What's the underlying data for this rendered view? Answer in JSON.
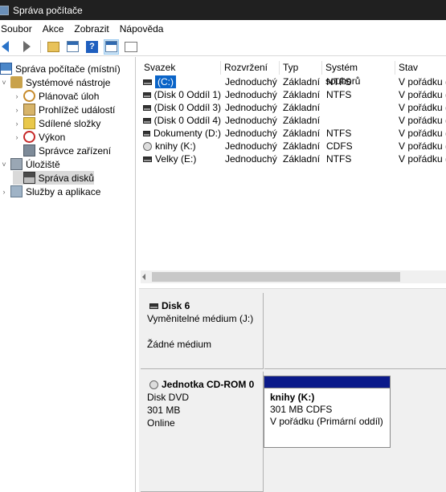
{
  "window": {
    "title": "Správa počítače"
  },
  "menu": [
    "Soubor",
    "Akce",
    "Zobrazit",
    "Nápověda"
  ],
  "tree": [
    {
      "label": "Správa počítače (místní)",
      "indent": 0,
      "exp": "",
      "icon": "computer"
    },
    {
      "label": "Systémové nástroje",
      "indent": 1,
      "exp": "˅",
      "icon": "tools"
    },
    {
      "label": "Plánovač úloh",
      "indent": 2,
      "exp": "›",
      "icon": "clock"
    },
    {
      "label": "Prohlížeč událostí",
      "indent": 2,
      "exp": "›",
      "icon": "events"
    },
    {
      "label": "Sdílené složky",
      "indent": 2,
      "exp": "›",
      "icon": "shared"
    },
    {
      "label": "Výkon",
      "indent": 2,
      "exp": "›",
      "icon": "perf"
    },
    {
      "label": "Správce zařízení",
      "indent": 2,
      "exp": "",
      "icon": "devmgr"
    },
    {
      "label": "Úložiště",
      "indent": 1,
      "exp": "˅",
      "icon": "storage"
    },
    {
      "label": "Správa disků",
      "indent": 2,
      "exp": "",
      "icon": "diskmgmt",
      "selected": true
    },
    {
      "label": "Služby a aplikace",
      "indent": 1,
      "exp": "›",
      "icon": "services"
    }
  ],
  "columns": [
    "Svazek",
    "Rozvržení",
    "Typ",
    "Systém souborů",
    "Stav"
  ],
  "volumes": [
    {
      "name": "(C:)",
      "layout": "Jednoduchý",
      "type": "Základní",
      "fs": "NTFS",
      "status": "V pořádku (",
      "icon": "disk",
      "selected": true
    },
    {
      "name": "(Disk 0 Oddíl 1)",
      "layout": "Jednoduchý",
      "type": "Základní",
      "fs": "NTFS",
      "status": "V pořádku (",
      "icon": "disk"
    },
    {
      "name": "(Disk 0 Oddíl 3)",
      "layout": "Jednoduchý",
      "type": "Základní",
      "fs": "",
      "status": "V pořádku (",
      "icon": "disk"
    },
    {
      "name": "(Disk 0 Oddíl 4)",
      "layout": "Jednoduchý",
      "type": "Základní",
      "fs": "",
      "status": "V pořádku (",
      "icon": "disk"
    },
    {
      "name": "Dokumenty (D:)",
      "layout": "Jednoduchý",
      "type": "Základní",
      "fs": "NTFS",
      "status": "V pořádku (",
      "icon": "disk"
    },
    {
      "name": "knihy (K:)",
      "layout": "Jednoduchý",
      "type": "Základní",
      "fs": "CDFS",
      "status": "V pořádku (",
      "icon": "cd"
    },
    {
      "name": "Velky (E:)",
      "layout": "Jednoduchý",
      "type": "Základní",
      "fs": "NTFS",
      "status": "V pořádku (",
      "icon": "disk"
    }
  ],
  "disks": {
    "disk6": {
      "title": "Disk 6",
      "line1": "Vyměnitelné médium (J:)",
      "line2": "Žádné médium"
    },
    "cdrom": {
      "title": "Jednotka CD-ROM 0",
      "line1": "Disk DVD",
      "line2": "301 MB",
      "line3": "Online"
    },
    "partition": {
      "title": "knihy  (K:)",
      "size": "301 MB CDFS",
      "status": "V pořádku (Primární oddíl)",
      "bar_color": "#0b1a8a"
    }
  }
}
